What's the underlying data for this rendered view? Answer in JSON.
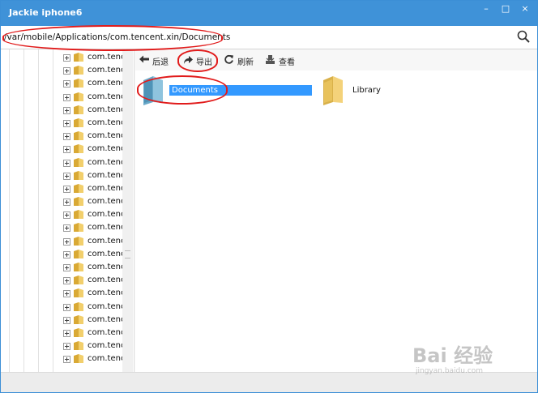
{
  "window": {
    "title": "Jackie iphone6",
    "minimize_label": "–",
    "maximize_label": "□",
    "close_label": "×"
  },
  "address": {
    "path": "/var/mobile/Applications/com.tencent.xin/Documents"
  },
  "tree": {
    "items": [
      {
        "label": "com.tencent"
      },
      {
        "label": "com.tencent"
      },
      {
        "label": "com.tencent"
      },
      {
        "label": "com.tencent"
      },
      {
        "label": "com.tencent"
      },
      {
        "label": "com.tencent"
      },
      {
        "label": "com.tencent"
      },
      {
        "label": "com.tencent"
      },
      {
        "label": "com.tencent"
      },
      {
        "label": "com.tencent"
      },
      {
        "label": "com.tencent"
      },
      {
        "label": "com.tencent"
      },
      {
        "label": "com.tencent"
      },
      {
        "label": "com.tencent"
      },
      {
        "label": "com.tencent"
      },
      {
        "label": "com.tencent"
      },
      {
        "label": "com.tencent"
      },
      {
        "label": "com.tencent"
      },
      {
        "label": "com.tencent"
      },
      {
        "label": "com.tencent"
      },
      {
        "label": "com.tencent"
      },
      {
        "label": "com.tencent"
      },
      {
        "label": "com.tencent"
      },
      {
        "label": "com.tencent"
      }
    ]
  },
  "toolbar": {
    "back_label": "后退",
    "export_label": "导出",
    "refresh_label": "刷新",
    "view_label": "查看"
  },
  "content": {
    "items": [
      {
        "label": "Documents",
        "selected": true
      },
      {
        "label": "Library",
        "selected": false
      }
    ]
  },
  "watermark": {
    "main": "Bai 经验",
    "sub": "jingyan.baidu.com"
  },
  "colors": {
    "titlebar": "#3f92d8",
    "selection": "#3399ff",
    "annotation": "#e11b1b"
  }
}
